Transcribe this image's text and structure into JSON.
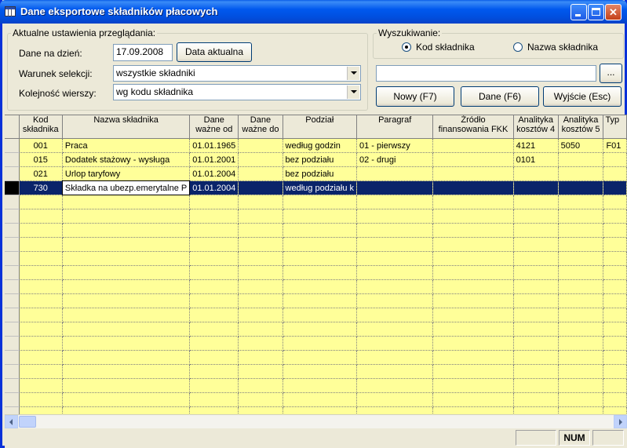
{
  "window": {
    "title": "Dane eksportowe składników płacowych"
  },
  "settings": {
    "legend": "Aktualne ustawienia przeglądania:",
    "date_label": "Dane na dzień:",
    "date_value": "17.09.2008",
    "current_date_button": "Data aktualna",
    "selection_label": "Warunek selekcji:",
    "selection_value": "wszystkie składniki",
    "order_label": "Kolejność wierszy:",
    "order_value": "wg kodu składnika"
  },
  "search": {
    "legend": "Wyszukiwanie:",
    "radio_code": "Kod składnika",
    "radio_name": "Nazwa składnika",
    "selected": "code",
    "input_value": "",
    "browse_button": "...",
    "new_button": "Nowy (F7)",
    "data_button": "Dane (F6)",
    "exit_button": "Wyjście (Esc)"
  },
  "table": {
    "columns": [
      "Kod składnika",
      "Nazwa składnika",
      "Dane ważne od",
      "Dane ważne do",
      "Podział",
      "Paragraf",
      "Źródło finansowania FKK",
      "Analityka kosztów 4",
      "Analityka kosztów 5",
      "Typ"
    ],
    "rows": [
      {
        "kod": "001",
        "nazwa": "Praca",
        "od": "01.01.1965",
        "do": "",
        "podzial": "według godzin",
        "paragraf": "01 - pierwszy",
        "zrodlo": "",
        "a4": "4121",
        "a5": "5050",
        "typ": "F01"
      },
      {
        "kod": "015",
        "nazwa": "Dodatek stażowy - wysługa",
        "od": "01.01.2001",
        "do": "",
        "podzial": "bez podziału",
        "paragraf": "02 - drugi",
        "zrodlo": "",
        "a4": "0101",
        "a5": "",
        "typ": ""
      },
      {
        "kod": "021",
        "nazwa": "Urlop taryfowy",
        "od": "01.01.2004",
        "do": "",
        "podzial": "bez podziału",
        "paragraf": "",
        "zrodlo": "",
        "a4": "",
        "a5": "",
        "typ": ""
      },
      {
        "kod": "730",
        "nazwa": "Składka na ubezp.emerytalne P",
        "od": "01.01.2004",
        "do": "",
        "podzial": "według podziału k",
        "paragraf": "",
        "zrodlo": "",
        "a4": "",
        "a5": "",
        "typ": ""
      }
    ],
    "selected_row": 3
  },
  "status": {
    "num": "NUM"
  }
}
